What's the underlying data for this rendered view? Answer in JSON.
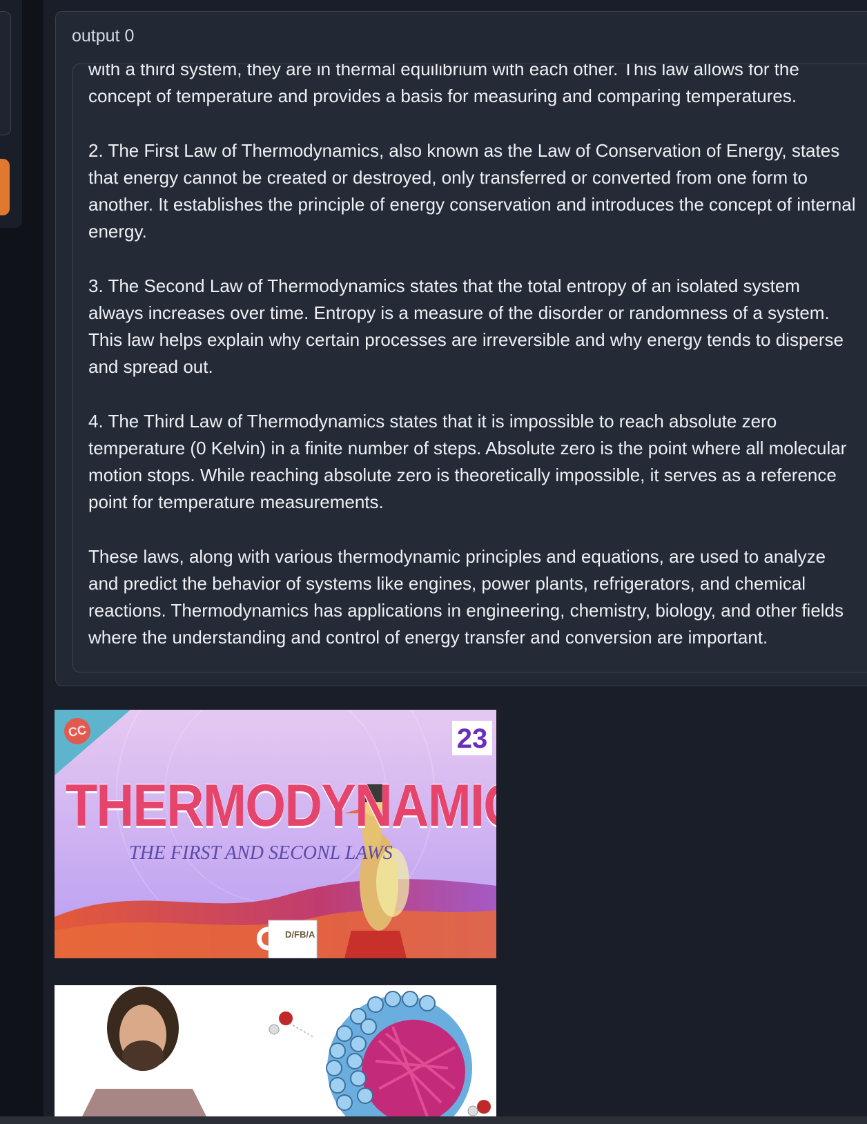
{
  "output": {
    "label": "output 0",
    "paragraphs": [
      "with a third system, they are in thermal equilibrium with each other. This law allows for the concept of temperature and provides a basis for measuring and comparing temperatures.",
      "2. The First Law of Thermodynamics, also known as the Law of Conservation of Energy, states that energy cannot be created or destroyed, only transferred or converted from one form to another. It establishes the principle of energy conservation and introduces the concept of internal energy.",
      "3. The Second Law of Thermodynamics states that the total entropy of an isolated system always increases over time. Entropy is a measure of the disorder or randomness of a system. This law helps explain why certain processes are irreversible and why energy tends to disperse and spread out.",
      "4. The Third Law of Thermodynamics states that it is impossible to reach absolute zero temperature (0 Kelvin) in a finite number of steps. Absolute zero is the point where all molecular motion stops. While reaching absolute zero is theoretically impossible, it serves as a reference point for temperature measurements.",
      "These laws, along with various thermodynamic principles and equations, are used to analyze and predict the behavior of systems like engines, power plants, refrigerators, and chemical reactions. Thermodynamics has applications in engineering, chemistry, biology, and other fields where the understanding and control of energy transfer and conversion are important."
    ]
  },
  "thumbnails": [
    {
      "cc_badge": "CC",
      "episode_number": "23",
      "title": "THERMODYNAMICS",
      "subtitle": "THE FIRST AND SECONL LAWS",
      "mug_text": "D/FB/A"
    },
    {
      "description_icon": "presenter-with-micelle-diagram"
    }
  ],
  "colors": {
    "accent_orange": "#e0782f",
    "panel_bg": "#222834",
    "page_bg": "#0f1219"
  }
}
